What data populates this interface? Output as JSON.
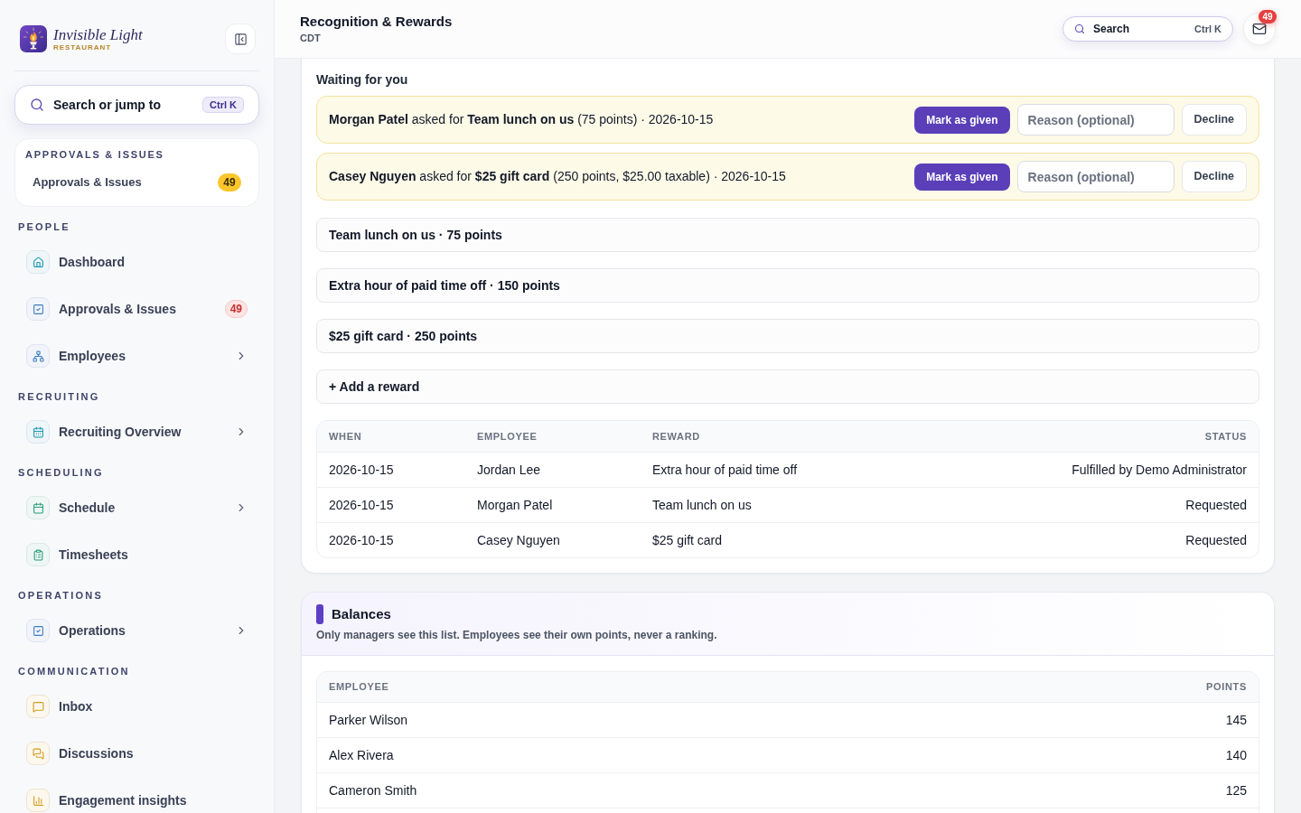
{
  "sidebar": {
    "brand": {
      "name": "Invisible Light",
      "tagline": "RESTAURANT"
    },
    "search": {
      "label": "Search or jump to",
      "shortcut": "Ctrl K"
    },
    "pinned": {
      "heading": "APPROVALS & ISSUES",
      "items": [
        {
          "label": "Approvals & Issues",
          "badge": "49"
        }
      ]
    },
    "sections": [
      {
        "heading": "PEOPLE",
        "items": [
          {
            "label": "Dashboard",
            "expandable": false
          },
          {
            "label": "Approvals & Issues",
            "badge": "49",
            "expandable": false
          },
          {
            "label": "Employees",
            "expandable": true
          }
        ]
      },
      {
        "heading": "RECRUITING",
        "items": [
          {
            "label": "Recruiting Overview",
            "expandable": true
          }
        ]
      },
      {
        "heading": "SCHEDULING",
        "items": [
          {
            "label": "Schedule",
            "expandable": true
          },
          {
            "label": "Timesheets",
            "expandable": false
          }
        ]
      },
      {
        "heading": "OPERATIONS",
        "items": [
          {
            "label": "Operations",
            "expandable": true
          }
        ]
      },
      {
        "heading": "COMMUNICATION",
        "items": [
          {
            "label": "Inbox",
            "expandable": false
          },
          {
            "label": "Discussions",
            "expandable": false
          },
          {
            "label": "Engagement insights",
            "expandable": false
          }
        ]
      }
    ]
  },
  "header": {
    "title": "Recognition & Rewards",
    "subtitle": "CDT",
    "search": {
      "label": "Search",
      "shortcut": "Ctrl K"
    },
    "inbox": {
      "badge": "49"
    }
  },
  "rewards_panel": {
    "waiting": {
      "heading": "Waiting for you",
      "requests": [
        {
          "text": "**Morgan Patel** asked for **Team lunch on us** (75 points) · 2026-10-15",
          "approve": "Mark as given",
          "reason_placeholder": "Reason (optional)",
          "decline": "Decline"
        },
        {
          "text": "**Casey Nguyen** asked for **$25 gift card** (250 points, $25.00 taxable) · 2026-10-15",
          "approve": "Mark as given",
          "reason_placeholder": "Reason (optional)",
          "decline": "Decline"
        }
      ]
    },
    "rewards": [
      {
        "label": "Team lunch on us · 75 points"
      },
      {
        "label": "Extra hour of paid time off · 150 points"
      },
      {
        "label": "$25 gift card · 250 points"
      }
    ],
    "add_reward": "+ Add a reward",
    "history": {
      "columns": [
        "WHEN",
        "EMPLOYEE",
        "REWARD",
        "STATUS"
      ],
      "rows": [
        [
          "2026-10-15",
          "Jordan Lee",
          "Extra hour of paid time off",
          "Fulfilled by Demo Administrator"
        ],
        [
          "2026-10-15",
          "Morgan Patel",
          "Team lunch on us",
          "Requested"
        ],
        [
          "2026-10-15",
          "Casey Nguyen",
          "$25 gift card",
          "Requested"
        ]
      ]
    }
  },
  "balances": {
    "title": "Balances",
    "note": "Only managers see this list. Employees see their own points, never a ranking.",
    "columns": [
      "EMPLOYEE",
      "POINTS"
    ],
    "rows": [
      [
        "Parker Wilson",
        "145"
      ],
      [
        "Alex Rivera",
        "140"
      ],
      [
        "Cameron Smith",
        "125"
      ]
    ]
  }
}
